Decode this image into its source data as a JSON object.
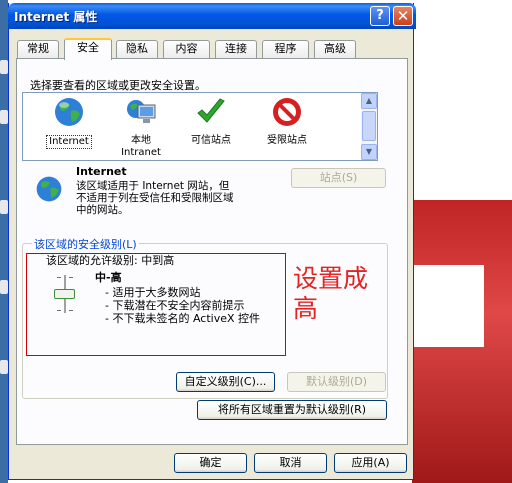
{
  "window": {
    "title": "Internet 属性",
    "help_label": "?",
    "close_label": "✕"
  },
  "tabs": [
    {
      "label": "常规"
    },
    {
      "label": "安全",
      "active": true
    },
    {
      "label": "隐私"
    },
    {
      "label": "内容"
    },
    {
      "label": "连接"
    },
    {
      "label": "程序"
    },
    {
      "label": "高级"
    }
  ],
  "security": {
    "instruction": "选择要查看的区域或更改安全设置。",
    "zones": [
      {
        "name": "Internet",
        "icon": "globe-icon",
        "selected": true
      },
      {
        "name": "本地\nIntranet",
        "icon": "monitor-icon"
      },
      {
        "name": "可信站点",
        "icon": "checkmark-icon"
      },
      {
        "name": "受限站点",
        "icon": "no-entry-icon"
      }
    ],
    "zone_title": "Internet",
    "zone_description": "该区域适用于 Internet 网站，但\n不适用于列在受信任和受限制区域\n中的网站。",
    "sites_button": "站点(S)",
    "level_group_title": "该区域的安全级别(L)",
    "allowed_levels": "该区域的允许级别: 中到高",
    "level_name": "中-高",
    "level_bullets": [
      "- 适用于大多数网站",
      "- 下载潜在不安全内容前提示",
      "- 不下载未签名的 ActiveX 控件"
    ],
    "slider_level": 0.5,
    "custom_level_button": "自定义级别(C)...",
    "default_level_button": "默认级别(D)",
    "reset_all_button": "将所有区域重置为默认级别(R)"
  },
  "annotation": {
    "text_line1": "设置成",
    "text_line2": "高",
    "color": "#e22424"
  },
  "footer": {
    "ok": "确定",
    "cancel": "取消",
    "apply": "应用(A)"
  }
}
